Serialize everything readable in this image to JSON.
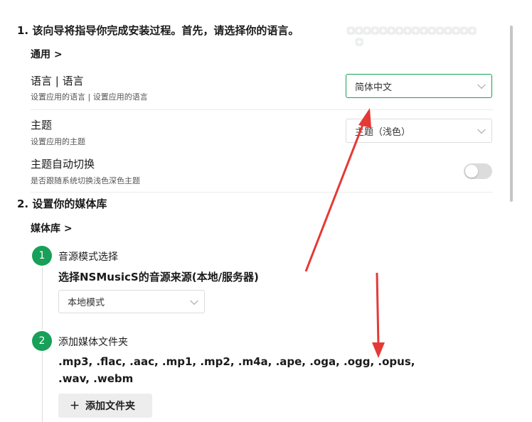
{
  "section1": {
    "heading": "1. 该向导将指导你完成安装过程。首先，请选择你的语言。",
    "link": "通用 >",
    "language": {
      "title": "语言 | 语言",
      "desc": "设置应用的语言 | 设置应用的语言",
      "value": "简体中文"
    },
    "theme": {
      "title": "主题",
      "desc": "设置应用的主题",
      "value": "主题（浅色）"
    },
    "auto_theme": {
      "title": "主题自动切换",
      "desc": "是否跟随系统切换浅色深色主题",
      "enabled": false
    }
  },
  "section2": {
    "heading": "2. 设置你的媒体库",
    "link": "媒体库 >",
    "steps": [
      {
        "number": "1",
        "title": "音源模式选择",
        "desc": "选择NSMusicS的音源来源(本地/服务器)",
        "select_value": "本地模式"
      },
      {
        "number": "2",
        "title": "添加媒体文件夹",
        "desc": ".mp3, .flac, .aac, .mp1, .mp2, .m4a, .ape, .oga, .ogg, .opus, .wav, .webm",
        "button_label": "添加文件夹",
        "button_icon": "＋"
      }
    ]
  },
  "colors": {
    "accent": "#18a058",
    "arrow": "#e53935"
  }
}
